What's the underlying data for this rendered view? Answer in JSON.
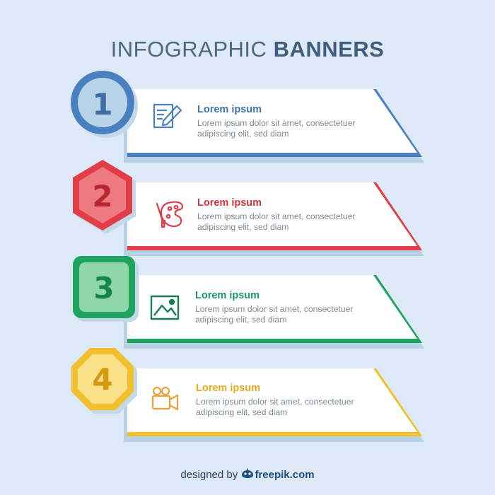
{
  "title": {
    "light": "INFOGRAPHIC",
    "bold": "BANNERS"
  },
  "colors": {
    "background": "#dde9f6",
    "shadow": "#b7d2e4",
    "blue": "#4a80bf",
    "red": "#e23c46",
    "green": "#1fa35f",
    "yellow": "#f0c12c"
  },
  "banners": [
    {
      "number": "1",
      "heading": "Lorem ipsum",
      "body": "Lorem ipsum dolor sit amet, consectetuer adipiscing elit, sed diam",
      "icon": "edit-document-icon",
      "badge_shape": "circle",
      "color": "#4a80bf"
    },
    {
      "number": "2",
      "heading": "Lorem ipsum",
      "body": "Lorem ipsum dolor sit amet, consectetuer adipiscing elit, sed diam",
      "icon": "paint-palette-icon",
      "badge_shape": "hexagon",
      "color": "#e23c46"
    },
    {
      "number": "3",
      "heading": "Lorem ipsum",
      "body": "Lorem ipsum dolor sit amet, consectetuer adipiscing elit, sed diam",
      "icon": "image-picture-icon",
      "badge_shape": "rounded-square",
      "color": "#1fa35f"
    },
    {
      "number": "4",
      "heading": "Lorem ipsum",
      "body": "Lorem ipsum dolor sit amet, consectetuer adipiscing elit, sed diam",
      "icon": "video-camera-icon",
      "badge_shape": "octagon",
      "color": "#f0c12c"
    }
  ],
  "credit": {
    "prefix": "designed by",
    "brand": "freepik.com"
  }
}
